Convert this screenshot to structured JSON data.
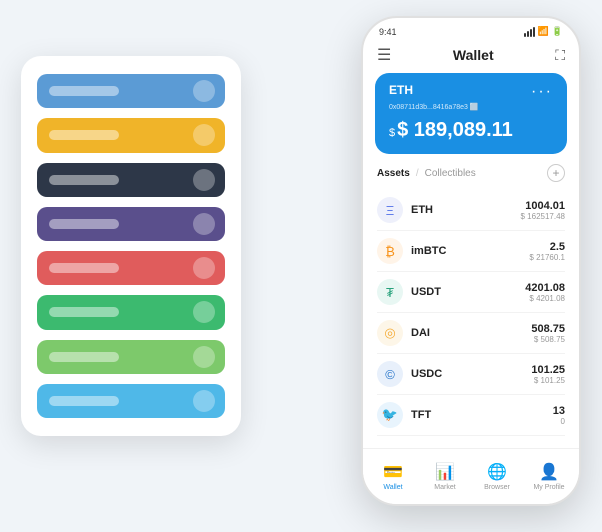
{
  "app": {
    "title": "Wallet"
  },
  "left_panel": {
    "bars": [
      {
        "color": "bar-blue",
        "label": "blue-bar"
      },
      {
        "color": "bar-yellow",
        "label": "yellow-bar"
      },
      {
        "color": "bar-dark",
        "label": "dark-bar"
      },
      {
        "color": "bar-purple",
        "label": "purple-bar"
      },
      {
        "color": "bar-red",
        "label": "red-bar"
      },
      {
        "color": "bar-green",
        "label": "green-bar"
      },
      {
        "color": "bar-lightgreen",
        "label": "lightgreen-bar"
      },
      {
        "color": "bar-skyblue",
        "label": "skyblue-bar"
      }
    ]
  },
  "phone": {
    "status_bar": {
      "time": "9:41"
    },
    "header": {
      "title": "Wallet"
    },
    "wallet_card": {
      "label": "ETH",
      "address": "0x08711d3b...8416a78e3 ⬜",
      "amount": "$ 189,089.11",
      "currency_symbol": "$"
    },
    "assets_header": {
      "tab_active": "Assets",
      "tab_divider": "/",
      "tab_inactive": "Collectibles"
    },
    "assets": [
      {
        "name": "ETH",
        "icon": "Ξ",
        "icon_color": "#627EEA",
        "icon_bg": "#eef0fb",
        "amount": "1004.01",
        "usd": "$ 162517.48"
      },
      {
        "name": "imBTC",
        "icon": "₿",
        "icon_color": "#F7931A",
        "icon_bg": "#fff4e8",
        "amount": "2.5",
        "usd": "$ 21760.1"
      },
      {
        "name": "USDT",
        "icon": "₮",
        "icon_color": "#26A17B",
        "icon_bg": "#e8f7f3",
        "amount": "4201.08",
        "usd": "$ 4201.08"
      },
      {
        "name": "DAI",
        "icon": "◎",
        "icon_color": "#F5AC37",
        "icon_bg": "#fdf6e8",
        "amount": "508.75",
        "usd": "$ 508.75"
      },
      {
        "name": "USDC",
        "icon": "©",
        "icon_color": "#2775CA",
        "icon_bg": "#e8f0fb",
        "amount": "101.25",
        "usd": "$ 101.25"
      },
      {
        "name": "TFT",
        "icon": "🐦",
        "icon_color": "#1DA1F2",
        "icon_bg": "#e8f4fd",
        "amount": "13",
        "usd": "0"
      }
    ],
    "bottom_nav": [
      {
        "label": "Wallet",
        "icon": "💳",
        "active": true
      },
      {
        "label": "Market",
        "icon": "📊",
        "active": false
      },
      {
        "label": "Browser",
        "icon": "🌐",
        "active": false
      },
      {
        "label": "My Profile",
        "icon": "👤",
        "active": false
      }
    ]
  }
}
